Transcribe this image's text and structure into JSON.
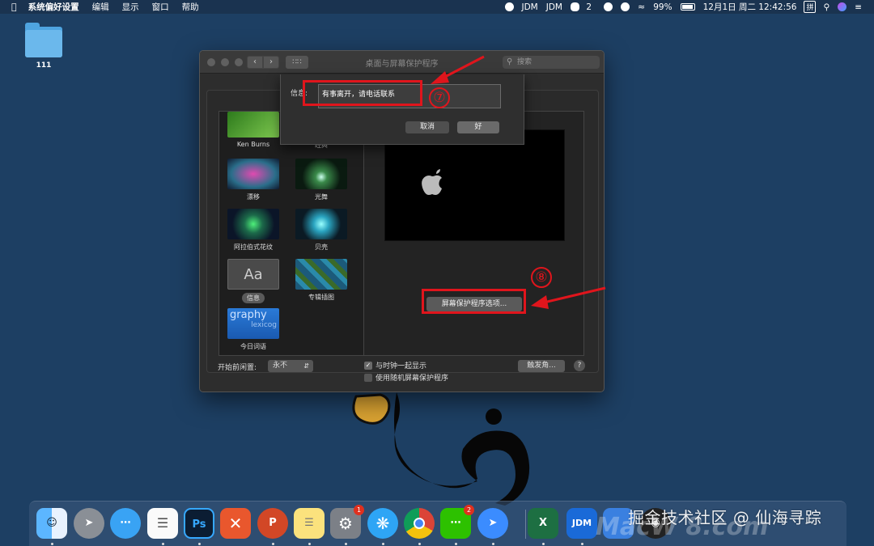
{
  "menubar": {
    "app": "系统偏好设置",
    "items": [
      "编辑",
      "显示",
      "窗口",
      "帮助"
    ],
    "status": {
      "jdm1": "JDM",
      "jdm2": "JDM",
      "wechat_count": "2",
      "battery": "99%",
      "datetime": "12月1日 周二  12:42:56",
      "input": "拼"
    }
  },
  "desktop": {
    "folder_name": "111"
  },
  "window": {
    "title": "桌面与屏幕保护程序",
    "search_placeholder": "搜索",
    "savers": [
      {
        "name": "Ken Burns"
      },
      {
        "name": "经典"
      },
      {
        "name": "漂移"
      },
      {
        "name": "光舞"
      },
      {
        "name": "阿拉伯式花纹"
      },
      {
        "name": "贝壳"
      },
      {
        "name": "信息",
        "thumb_text": "Aa",
        "selected": true
      },
      {
        "name": "专辑插图"
      },
      {
        "name": "今日词语",
        "thumb_text": "graphy",
        "thumb_text2": "lexicog"
      }
    ],
    "options_button": "屏幕保护程序选项...",
    "start_label": "开始前闲置:",
    "start_value": "永不",
    "show_clock_label": "与时钟一起显示",
    "show_clock_checked": true,
    "random_label": "使用随机屏幕保护程序",
    "random_checked": false,
    "hot_corners_button": "触发角...",
    "help_button": "?"
  },
  "sheet": {
    "label": "信息:",
    "message_value": "有事离开，请电话联系",
    "cancel": "取消",
    "ok": "好"
  },
  "annotations": {
    "step7": "⑦",
    "step8": "⑧",
    "color": "#e0151c"
  },
  "dock": {
    "apps": [
      {
        "name": "Finder",
        "icon": "finder-icon"
      },
      {
        "name": "Launchpad",
        "icon": "rocket-icon"
      },
      {
        "name": "Messages",
        "icon": "chat-icon"
      },
      {
        "name": "Reminders",
        "icon": "list-icon"
      },
      {
        "name": "Photoshop",
        "label": "Ps",
        "icon": "photoshop-icon"
      },
      {
        "name": "XMind",
        "icon": "xmind-icon"
      },
      {
        "name": "PowerPoint",
        "label": "P",
        "icon": "powerpoint-icon"
      },
      {
        "name": "Notes",
        "icon": "notes-icon"
      },
      {
        "name": "System Preferences",
        "icon": "gear-icon",
        "badge": "1"
      },
      {
        "name": "Safari",
        "icon": "compass-icon"
      },
      {
        "name": "Chrome",
        "icon": "chrome-icon"
      },
      {
        "name": "WeChat",
        "icon": "wechat-icon",
        "badge": "2"
      },
      {
        "name": "DingTalk",
        "icon": "dingtalk-icon"
      },
      {
        "name": "Excel",
        "label": "X",
        "icon": "excel-icon"
      },
      {
        "name": "JDM",
        "label": "JDM",
        "icon": "jdm-icon"
      },
      {
        "name": "App",
        "icon": "app-icon"
      },
      {
        "name": "QQ",
        "icon": "qq-icon"
      }
    ]
  },
  "watermark": "掘金技术社区 @ 仙海寻踪",
  "watermark2": "MacW 8.com"
}
